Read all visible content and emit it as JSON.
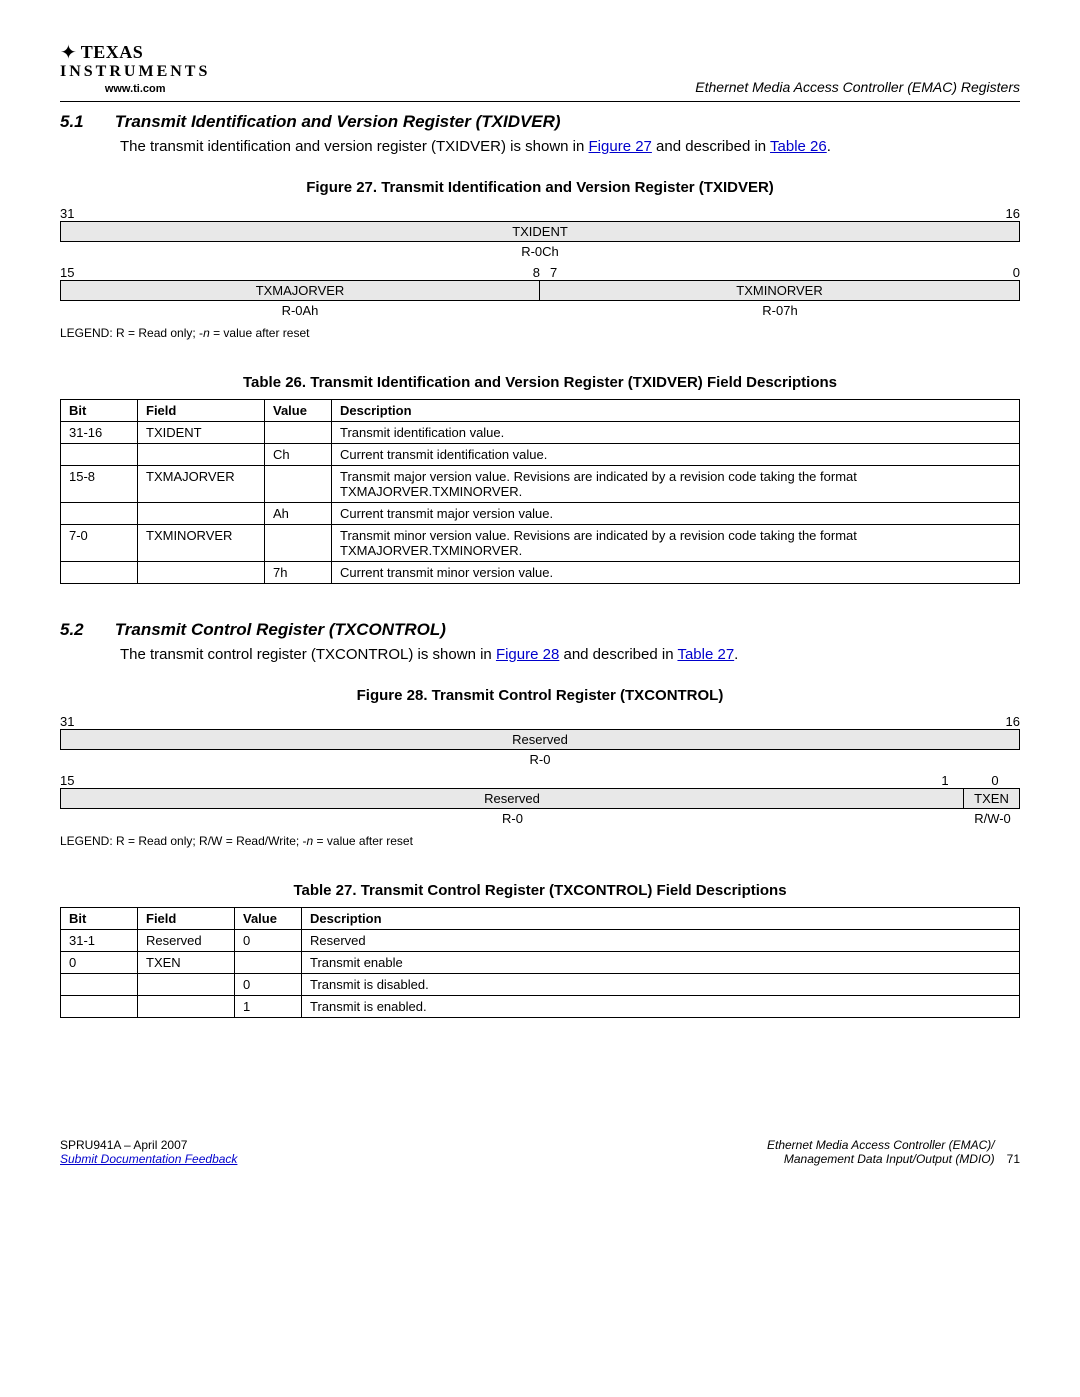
{
  "header": {
    "brand_top": "TEXAS",
    "brand_bottom": "INSTRUMENTS",
    "url": "www.ti.com",
    "right": "Ethernet Media Access Controller (EMAC) Registers"
  },
  "s51": {
    "num": "5.1",
    "title": "Transmit Identification and Version Register (TXIDVER)",
    "intro_a": "The transmit identification and version register (TXIDVER) is shown in ",
    "link1": "Figure 27",
    "intro_b": " and described in ",
    "link2": "Table 26",
    "intro_c": "."
  },
  "fig27": {
    "title": "Figure 27. Transmit Identification and Version Register (TXIDVER)",
    "bit31": "31",
    "bit16": "16",
    "row1_field": "TXIDENT",
    "row1_reset": "R-0Ch",
    "bit15": "15",
    "bit8": "8",
    "bit7": "7",
    "bit0": "0",
    "row2a_field": "TXMAJORVER",
    "row2b_field": "TXMINORVER",
    "row2a_reset": "R-0Ah",
    "row2b_reset": "R-07h",
    "legend_a": "LEGEND: R = Read only; -",
    "legend_n": "n",
    "legend_b": " = value after reset"
  },
  "tbl26": {
    "title": "Table 26. Transmit Identification and Version Register (TXIDVER) Field Descriptions",
    "hBit": "Bit",
    "hField": "Field",
    "hValue": "Value",
    "hDesc": "Description",
    "r1_bit": "31-16",
    "r1_field": "TXIDENT",
    "r1_val": "",
    "r1_desc": "Transmit identification value.",
    "r2_bit": "",
    "r2_field": "",
    "r2_val": "Ch",
    "r2_desc": "Current transmit identification value.",
    "r3_bit": "15-8",
    "r3_field": "TXMAJORVER",
    "r3_val": "",
    "r3_desc": "Transmit major version value. Revisions are indicated by a revision code taking the format TXMAJORVER.TXMINORVER.",
    "r4_bit": "",
    "r4_field": "",
    "r4_val": "Ah",
    "r4_desc": "Current transmit major version value.",
    "r5_bit": "7-0",
    "r5_field": "TXMINORVER",
    "r5_val": "",
    "r5_desc": "Transmit minor version value. Revisions are indicated by a revision code taking the format TXMAJORVER.TXMINORVER.",
    "r6_bit": "",
    "r6_field": "",
    "r6_val": "7h",
    "r6_desc": "Current transmit minor version value."
  },
  "s52": {
    "num": "5.2",
    "title": "Transmit Control Register (TXCONTROL)",
    "intro_a": "The transmit control register (TXCONTROL) is shown in ",
    "link1": "Figure 28",
    "intro_b": " and described in ",
    "link2": "Table 27",
    "intro_c": "."
  },
  "fig28": {
    "title": "Figure 28. Transmit Control Register (TXCONTROL)",
    "bit31": "31",
    "bit16": "16",
    "row1_field": "Reserved",
    "row1_reset": "R-0",
    "bit15": "15",
    "bit1": "1",
    "bit0": "0",
    "row2a_field": "Reserved",
    "row2b_field": "TXEN",
    "row2a_reset": "R-0",
    "row2b_reset": "R/W-0",
    "legend_a": "LEGEND: R = Read only; R/W = Read/Write; -",
    "legend_n": "n",
    "legend_b": " = value after reset"
  },
  "tbl27": {
    "title": "Table 27. Transmit Control Register (TXCONTROL) Field Descriptions",
    "hBit": "Bit",
    "hField": "Field",
    "hValue": "Value",
    "hDesc": "Description",
    "r1_bit": "31-1",
    "r1_field": "Reserved",
    "r1_val": "0",
    "r1_desc": "Reserved",
    "r2_bit": "0",
    "r2_field": "TXEN",
    "r2_val": "",
    "r2_desc": "Transmit enable",
    "r3_bit": "",
    "r3_field": "",
    "r3_val": "0",
    "r3_desc": "Transmit is disabled.",
    "r4_bit": "",
    "r4_field": "",
    "r4_val": "1",
    "r4_desc": "Transmit is enabled."
  },
  "footer": {
    "left_a": "SPRU941A – April 2007",
    "left_link": "Submit Documentation Feedback",
    "right_a": "Ethernet Media Access Controller (EMAC)/",
    "right_b": "Management Data Input/Output (MDIO)",
    "pagenum": "71"
  }
}
